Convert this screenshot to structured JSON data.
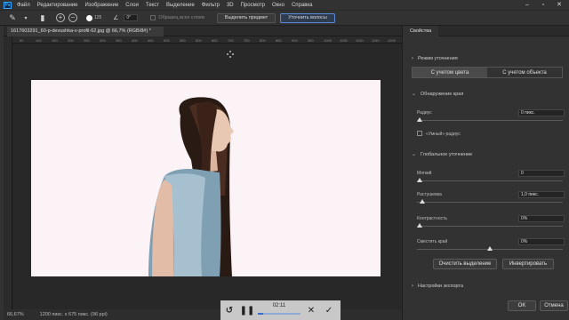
{
  "menu": {
    "logo": "Ps",
    "items": [
      "Файл",
      "Редактирование",
      "Изображение",
      "Слои",
      "Текст",
      "Выделение",
      "Фильтр",
      "3D",
      "Просмотр",
      "Окно",
      "Справка"
    ]
  },
  "options_bar": {
    "brush_size": "125",
    "angle": "0°",
    "sample_all_layers": "Образец всех слоев",
    "select_subject": "Выделить предмет",
    "refine_hair": "Уточнить волосы"
  },
  "document": {
    "tab_title": "1617603291_60-p-devushka-v-profil-62.jpg @ 66,7% (RGB/8#) *",
    "ruler_ticks": [
      "50",
      "100",
      "150",
      "200",
      "250",
      "300",
      "350",
      "400",
      "450",
      "500",
      "550",
      "600",
      "650",
      "700",
      "750",
      "800",
      "850",
      "900",
      "950",
      "1000",
      "1050",
      "1100",
      "1150",
      "1200"
    ]
  },
  "status": {
    "zoom": "66,67%",
    "doc_size": "1200 пикс. x 675 пикс. (96 ppi)"
  },
  "player": {
    "time": "02:11",
    "progress": 0.12
  },
  "panel": {
    "tab": "Свойства",
    "view_mode_heading": "Режим уточнения",
    "mode_color": "С учетом цвета",
    "mode_object": "С учетом объекта",
    "edge_detection_heading": "Обнаружение края",
    "radius_label": "Радиус",
    "radius_value": "0 пикс.",
    "radius_slider": 0.0,
    "smart_radius_label": "«Умный» радиус",
    "global_heading": "Глобальное уточнение",
    "smooth_label": "Мягкий",
    "smooth_value": "0",
    "smooth_slider": 0.0,
    "feather_label": "Растушевка",
    "feather_value": "1,0 пикс.",
    "feather_slider": 0.02,
    "contrast_label": "Контрастность",
    "contrast_value": "0%",
    "contrast_slider": 0.0,
    "shift_edge_label": "Сместить край",
    "shift_edge_value": "0%",
    "shift_edge_slider": 0.5,
    "clear_selection": "Очистить выделение",
    "invert": "Инвертировать",
    "export_heading": "Настройки экспорта",
    "ok": "OK",
    "cancel": "Отмена"
  }
}
